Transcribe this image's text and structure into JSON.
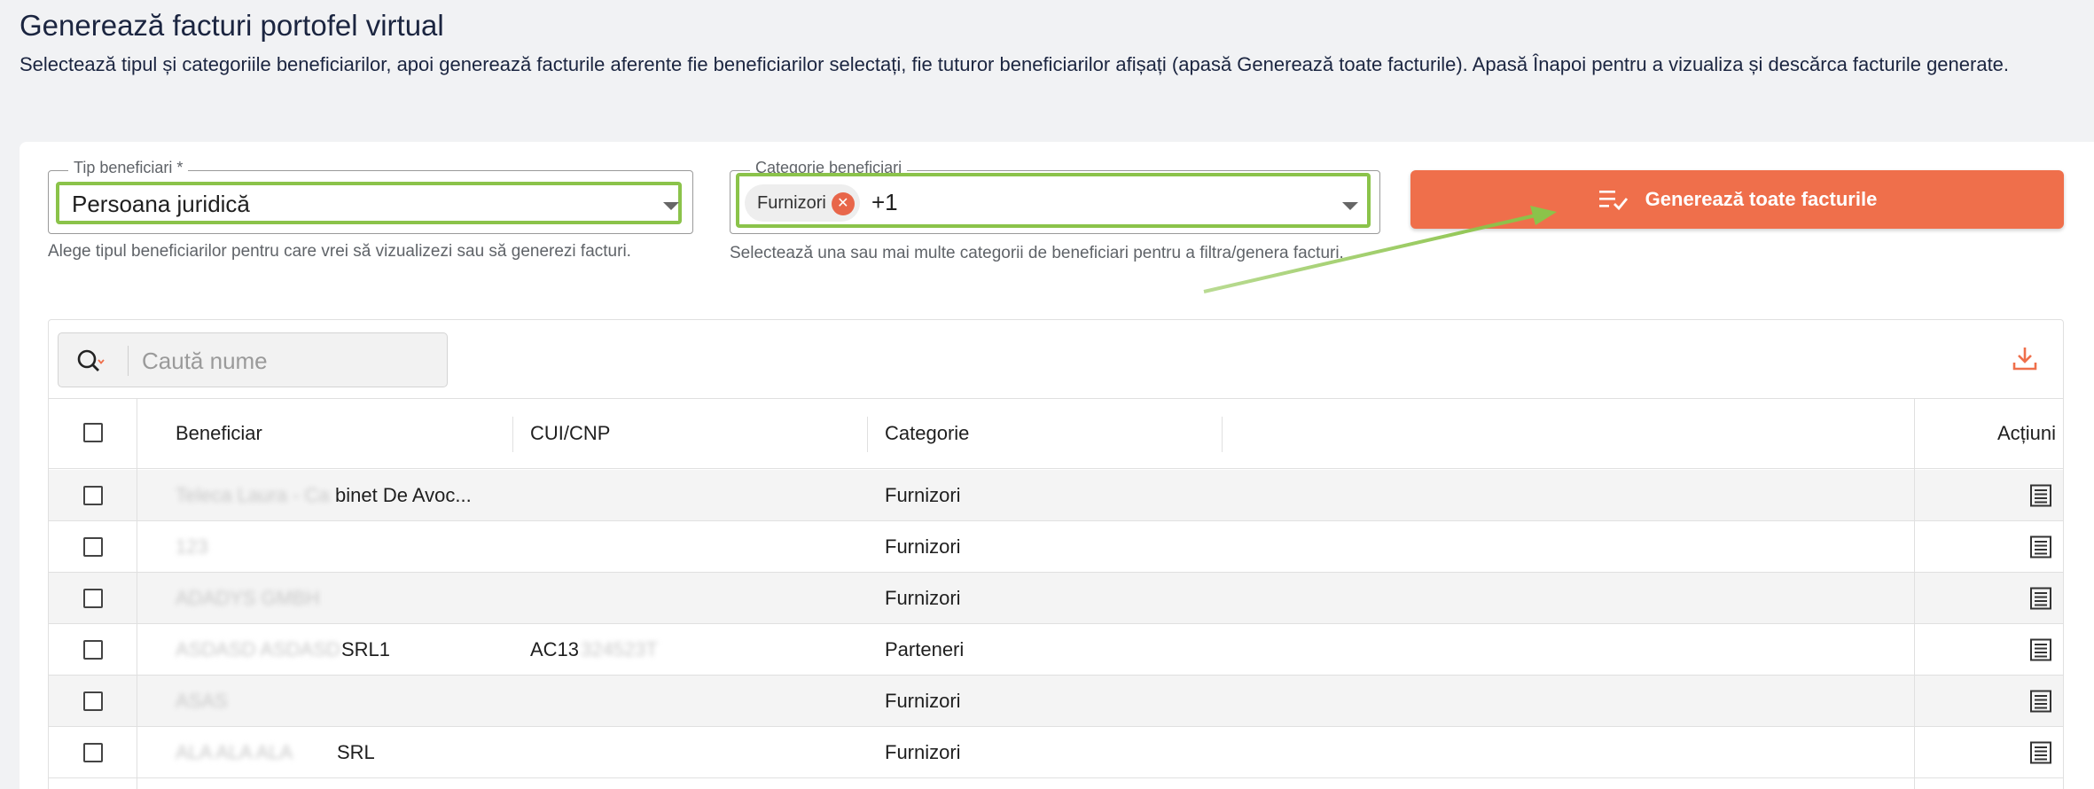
{
  "page": {
    "title": "Generează facturi portofel virtual",
    "description": "Selectează tipul și categoriile beneficiarilor, apoi generează facturile aferente fie beneficiarilor selectați, fie tuturor beneficiarilor afișați (apasă Generează toate facturile). Apasă Înapoi pentru a vizualiza și descărca facturile generate."
  },
  "filters": {
    "tip": {
      "label": "Tip beneficiari *",
      "value": "Persoana juridică",
      "helper": "Alege tipul beneficiarilor pentru care vrei să vizualizezi sau să generezi facturi."
    },
    "categorie": {
      "label": "Categorie beneficiari",
      "chip": "Furnizori",
      "more": "+1",
      "helper": "Selectează una sau mai multe categorii de beneficiari pentru a filtra/genera facturi."
    },
    "generate_label": "Generează toate facturile"
  },
  "search": {
    "placeholder": "Caută nume"
  },
  "table": {
    "headers": {
      "beneficiar": "Beneficiar",
      "cui": "CUI/CNP",
      "categorie": "Categorie",
      "actiuni": "Acțiuni"
    },
    "rows": [
      {
        "name_visible": "binet De Avoc...",
        "name_blur": "Teleca Laura - Ca",
        "cui_visible": "",
        "cui_blur": "",
        "categorie": "Furnizori"
      },
      {
        "name_visible": "",
        "name_blur": "123",
        "cui_visible": "",
        "cui_blur": "",
        "categorie": "Furnizori"
      },
      {
        "name_visible": "",
        "name_blur": "ADADYS GMBH",
        "cui_visible": "",
        "cui_blur": "",
        "categorie": "Furnizori"
      },
      {
        "name_visible": "SRL1",
        "name_blur": "ASDASD ASDASD",
        "cui_visible": "AC13",
        "cui_blur": "324523T",
        "categorie": "Parteneri"
      },
      {
        "name_visible": "",
        "name_blur": "ASAS",
        "cui_visible": "",
        "cui_blur": "",
        "categorie": "Furnizori"
      },
      {
        "name_visible": "SRL",
        "name_blur": "ALA ALA ALA",
        "cui_visible": "",
        "cui_blur": "",
        "categorie": "Furnizori"
      }
    ]
  },
  "colors": {
    "accent": "#ef6f4b",
    "highlight": "#8bc34a",
    "title": "#1b2540"
  },
  "icons": {
    "search": "search-icon",
    "download": "download-icon",
    "generate": "list-check-icon",
    "row_action": "invoice-icon",
    "chip_remove": "close-circle-icon"
  }
}
